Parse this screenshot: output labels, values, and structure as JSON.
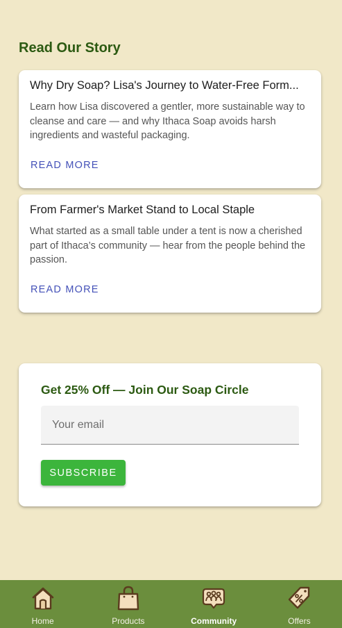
{
  "story": {
    "title": "Read Our Story",
    "articles": [
      {
        "title": "Why Dry Soap? Lisa's Journey to Water-Free Form...",
        "body": "Learn how Lisa discovered a gentler, more sustainable way to cleanse and care — and why Ithaca Soap avoids harsh ingredients and wasteful packaging.",
        "action": "Read More"
      },
      {
        "title": "From Farmer's Market Stand to Local Staple",
        "body": "What started as a small table under a tent is now a cherished part of Ithaca’s community — hear from the people behind the passion.",
        "action": "Read More"
      }
    ]
  },
  "promo": {
    "title": "Get 25% Off — Join Our Soap Circle",
    "email_placeholder": "Your email",
    "email_value": "",
    "subscribe_label": "Subscribe"
  },
  "nav": {
    "items": [
      {
        "label": "Home",
        "icon": "home-icon"
      },
      {
        "label": "Products",
        "icon": "shopping-bag-icon"
      },
      {
        "label": "Community",
        "icon": "community-icon",
        "active": true
      },
      {
        "label": "Offers",
        "icon": "offer-tag-icon"
      }
    ]
  },
  "colors": {
    "background": "#f1e8c8",
    "accent_green": "#2c5a12",
    "button_green": "#3cb53c",
    "nav_bar": "#6b8e3d",
    "link_blue": "#4451b8",
    "icon_fill": "#f3dfbd",
    "icon_stroke": "#5a3b1e"
  }
}
